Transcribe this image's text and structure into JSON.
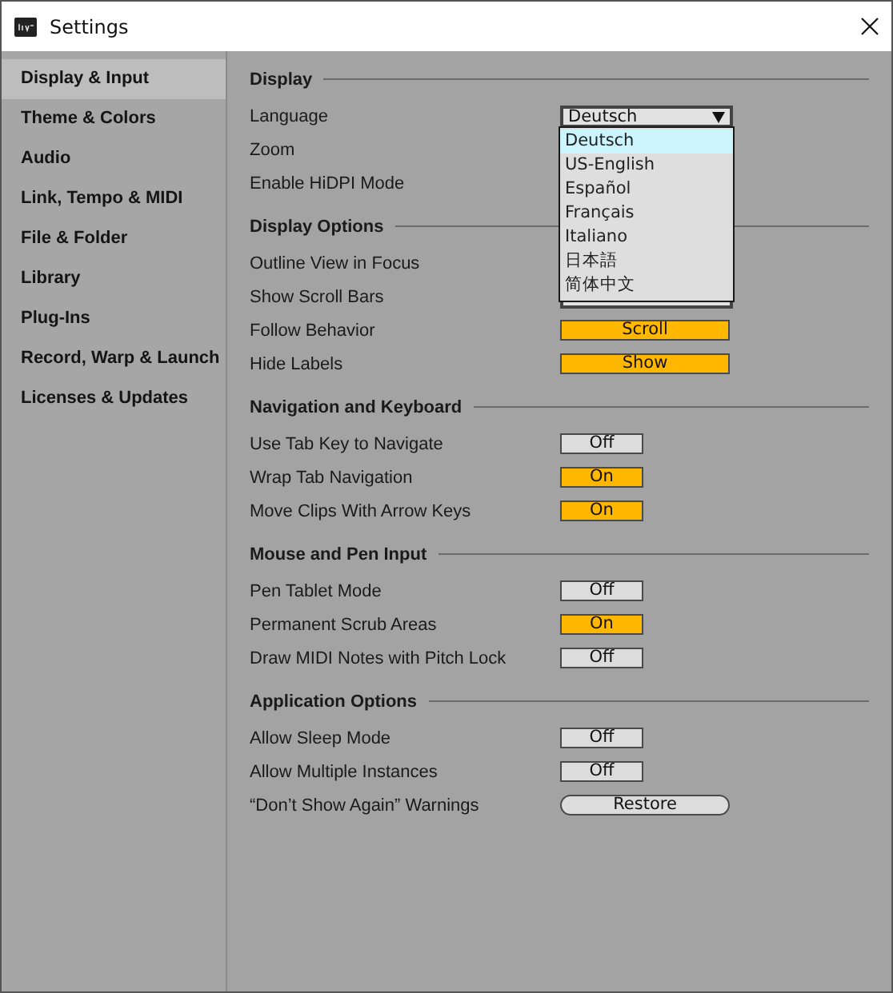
{
  "window": {
    "title": "Settings"
  },
  "sidebar": {
    "items": [
      {
        "label": "Display & Input",
        "selected": true
      },
      {
        "label": "Theme & Colors",
        "selected": false
      },
      {
        "label": "Audio",
        "selected": false
      },
      {
        "label": "Link, Tempo & MIDI",
        "selected": false
      },
      {
        "label": "File & Folder",
        "selected": false
      },
      {
        "label": "Library",
        "selected": false
      },
      {
        "label": "Plug-Ins",
        "selected": false
      },
      {
        "label": "Record, Warp & Launch",
        "selected": false
      },
      {
        "label": "Licenses & Updates",
        "selected": false
      }
    ]
  },
  "sections": [
    {
      "title": "Display",
      "rows": [
        {
          "label": "Language",
          "kind": "select",
          "value": "Deutsch",
          "expanded": true,
          "options": [
            {
              "label": "Deutsch",
              "selected": true
            },
            {
              "label": "US-English",
              "selected": false
            },
            {
              "label": "Español",
              "selected": false
            },
            {
              "label": "Français",
              "selected": false
            },
            {
              "label": "Italiano",
              "selected": false
            },
            {
              "label": "日本語",
              "selected": false
            },
            {
              "label": "简体中文",
              "selected": false
            }
          ]
        },
        {
          "label": "Zoom",
          "kind": "covered"
        },
        {
          "label": "Enable HiDPI Mode",
          "kind": "covered"
        }
      ]
    },
    {
      "title": "Display Options",
      "rows": [
        {
          "label": "Outline View in Focus",
          "kind": "covered"
        },
        {
          "label": "Show Scroll Bars",
          "kind": "select"
        },
        {
          "label": "Follow Behavior",
          "kind": "wide",
          "value": "Scroll",
          "on": true
        },
        {
          "label": "Hide Labels",
          "kind": "wide",
          "value": "Show",
          "on": true
        }
      ]
    },
    {
      "title": "Navigation and Keyboard",
      "rows": [
        {
          "label": "Use Tab Key to Navigate",
          "kind": "toggle",
          "value": "Off",
          "on": false
        },
        {
          "label": "Wrap Tab Navigation",
          "kind": "toggle",
          "value": "On",
          "on": true
        },
        {
          "label": "Move Clips With Arrow Keys",
          "kind": "toggle",
          "value": "On",
          "on": true
        }
      ]
    },
    {
      "title": "Mouse and Pen Input",
      "rows": [
        {
          "label": "Pen Tablet Mode",
          "kind": "toggle",
          "value": "Off",
          "on": false
        },
        {
          "label": "Permanent Scrub Areas",
          "kind": "toggle",
          "value": "On",
          "on": true
        },
        {
          "label": "Draw MIDI Notes with Pitch Lock",
          "kind": "toggle",
          "value": "Off",
          "on": false
        }
      ]
    },
    {
      "title": "Application Options",
      "rows": [
        {
          "label": "Allow Sleep Mode",
          "kind": "toggle",
          "value": "Off",
          "on": false
        },
        {
          "label": "Allow Multiple Instances",
          "kind": "toggle",
          "value": "Off",
          "on": false
        },
        {
          "label": "“Don’t Show Again” Warnings",
          "kind": "button",
          "value": "Restore"
        }
      ]
    }
  ]
}
